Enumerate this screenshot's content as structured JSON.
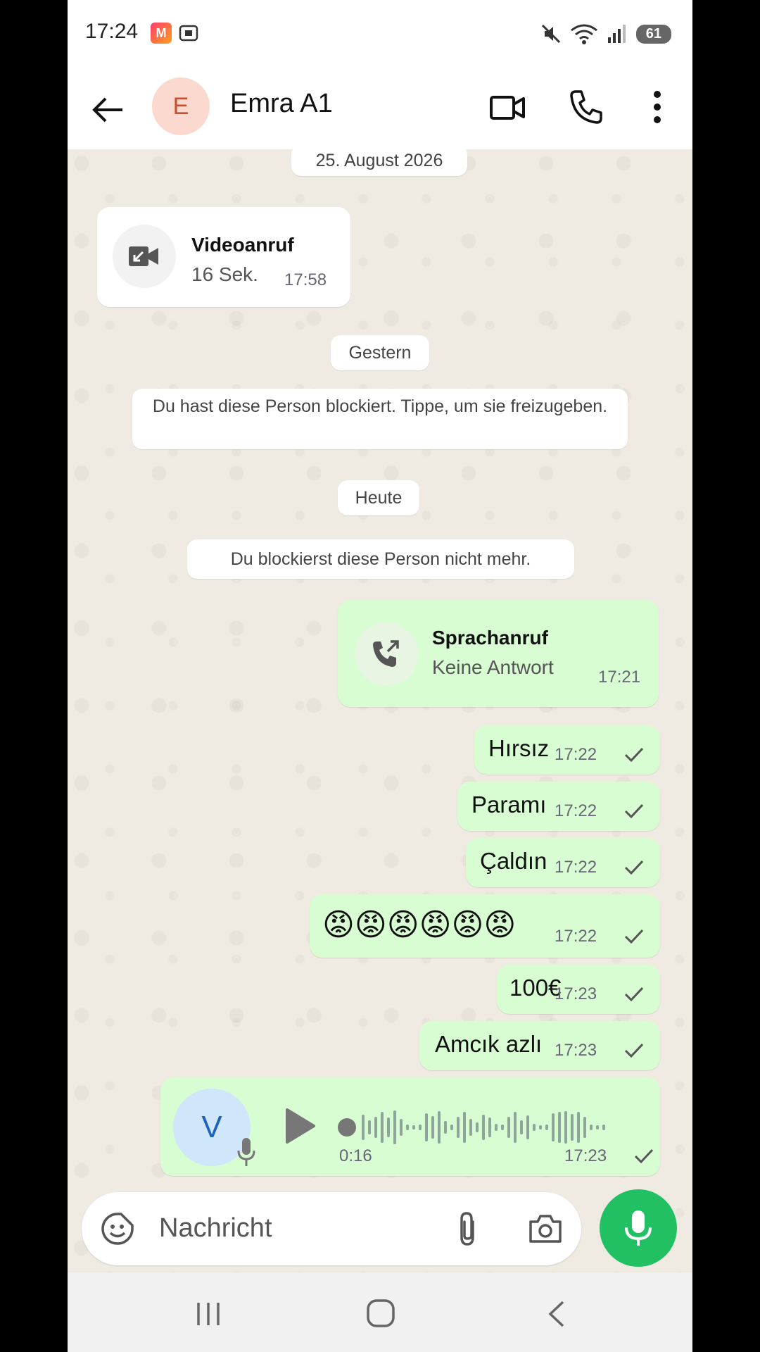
{
  "status_bar": {
    "time": "17:24",
    "battery": "61"
  },
  "header": {
    "contact_name": "Emra A1",
    "avatar_letter": "E"
  },
  "chat": {
    "date_1": "25. August 2026",
    "video_call": {
      "title": "Videoanruf",
      "subtitle": "16 Sek.",
      "time": "17:58"
    },
    "date_2": "Gestern",
    "system_blocked": "Du hast diese Person blockiert. Tippe, um sie freizugeben.",
    "date_3": "Heute",
    "system_unblocked": "Du blockierst diese Person nicht mehr.",
    "voice_call": {
      "title": "Sprachanruf",
      "subtitle": "Keine Antwort",
      "time": "17:21"
    },
    "messages": [
      {
        "text": "Hırsız",
        "time": "17:22"
      },
      {
        "text": "Paramı",
        "time": "17:22"
      },
      {
        "text": "Çaldın",
        "time": "17:22"
      },
      {
        "text": "😡😡😡😡😡😡",
        "time": "17:22"
      },
      {
        "text": "100€",
        "time": "17:23"
      },
      {
        "text": "Amcık azlı",
        "time": "17:23"
      }
    ],
    "voice_message": {
      "avatar_letter": "V",
      "duration": "0:16",
      "time": "17:23"
    }
  },
  "composer": {
    "placeholder": "Nachricht"
  },
  "colors": {
    "outgoing_bubble": "#d9fdd3",
    "accent_green": "#21c063",
    "chat_bg": "#efeae2"
  }
}
